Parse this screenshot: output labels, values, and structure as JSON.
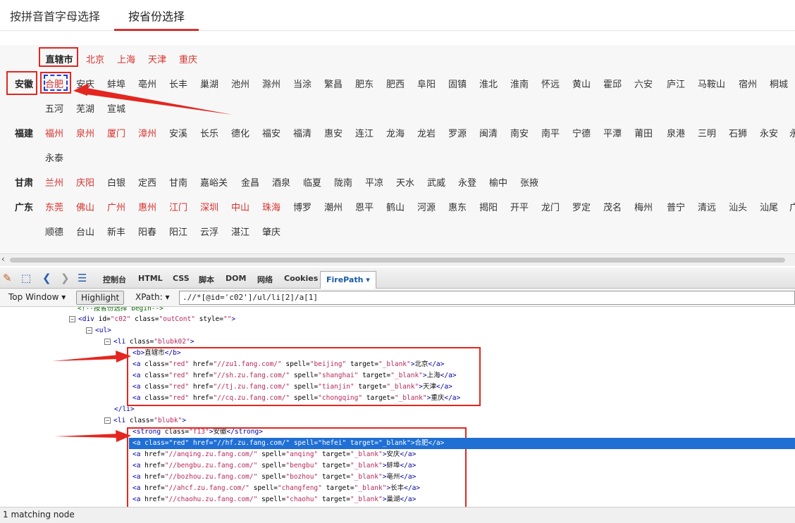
{
  "tabs": {
    "pinyin": "按拼音首字母选择",
    "province": "按省份选择"
  },
  "provinces": {
    "zhixiashi": {
      "label": "直辖市",
      "cities": [
        "北京",
        "上海",
        "天津",
        "重庆"
      ]
    },
    "anhui": {
      "label": "安徽",
      "cities": [
        "合肥",
        "安庆",
        "蚌埠",
        "亳州",
        "长丰",
        "巢湖",
        "池州",
        "滁州",
        "当涂",
        "繁昌",
        "肥东",
        "肥西",
        "阜阳",
        "固镇",
        "淮北",
        "淮南",
        "怀远",
        "黄山",
        "霍邱",
        "六安",
        "庐江",
        "马鞍山",
        "宿州",
        "桐城"
      ],
      "cities2": [
        "五河",
        "芜湖",
        "宣城"
      ]
    },
    "fujian": {
      "label": "福建",
      "cities": [
        "福州",
        "泉州",
        "厦门",
        "漳州",
        "安溪",
        "长乐",
        "德化",
        "福安",
        "福清",
        "惠安",
        "连江",
        "龙海",
        "龙岩",
        "罗源",
        "闽清",
        "南安",
        "南平",
        "宁德",
        "平潭",
        "莆田",
        "泉港",
        "三明",
        "石狮",
        "永安",
        "永"
      ],
      "cities2": [
        "永泰"
      ]
    },
    "gansu": {
      "label": "甘肃",
      "cities": [
        "兰州",
        "庆阳",
        "白银",
        "定西",
        "甘南",
        "嘉峪关",
        "金昌",
        "酒泉",
        "临夏",
        "陇南",
        "平凉",
        "天水",
        "武威",
        "永登",
        "榆中",
        "张掖"
      ]
    },
    "guangdong": {
      "label": "广东",
      "cities": [
        "东莞",
        "佛山",
        "广州",
        "惠州",
        "江门",
        "深圳",
        "中山",
        "珠海",
        "博罗",
        "潮州",
        "恩平",
        "鹤山",
        "河源",
        "惠东",
        "揭阳",
        "开平",
        "龙门",
        "罗定",
        "茂名",
        "梅州",
        "普宁",
        "清远",
        "汕头",
        "汕尾",
        "广"
      ],
      "cities2": [
        "顺德",
        "台山",
        "新丰",
        "阳春",
        "阳江",
        "云浮",
        "湛江",
        "肇庆"
      ]
    }
  },
  "firebug": {
    "tabs": [
      "控制台",
      "HTML",
      "CSS",
      "脚本",
      "DOM",
      "网络",
      "Cookies"
    ],
    "active_tab": "FirePath ▾",
    "top_window": "Top Window ▾",
    "highlight": "Highlight",
    "xpath_label": "XPath: ▾",
    "xpath_value": ".//*[@id='c02']/ul/li[2]/a[1]"
  },
  "code": {
    "l0": "<!--按省份选择 begin-->",
    "l1a": "<div",
    "l1b": " id=",
    "l1c": "\"c02\"",
    "l1d": " class=",
    "l1e": "\"outCont\"",
    "l1f": " style=",
    "l1g": "\"\"",
    "l1h": ">",
    "l2": "<ul>",
    "l3a": "<li",
    "l3b": " class=",
    "l3c": "\"blubk02\"",
    "l3d": ">",
    "l4a": "<b>",
    "l4b": "直辖市",
    "l4c": "</b>",
    "a1": {
      "href": "\"//zu1.fang.com/\"",
      "spell": "\"beijing\"",
      "text": "北京"
    },
    "a2": {
      "href": "\"//sh.zu.fang.com/\"",
      "spell": "\"shanghai\"",
      "text": "上海"
    },
    "a3": {
      "href": "\"//tj.zu.fang.com/\"",
      "spell": "\"tianjin\"",
      "text": "天津"
    },
    "a4": {
      "href": "\"//cq.zu.fang.com/\"",
      "spell": "\"chongqing\"",
      "text": "重庆"
    },
    "li_close": "</li>",
    "l5a": "<li",
    "l5b": " class=",
    "l5c": "\"blubk\"",
    "l5d": ">",
    "l6a": "<strong",
    "l6b": " class=",
    "l6c": "\"f13\"",
    "l6d": ">",
    "l6e": "安徽",
    "l6f": "</strong>",
    "b1": {
      "href": "\"//hf.zu.fang.com/\"",
      "spell": "\"hefei\"",
      "text": "合肥"
    },
    "b2": {
      "href": "\"//anqing.zu.fang.com/\"",
      "spell": "\"anqing\"",
      "text": "安庆"
    },
    "b3": {
      "href": "\"//bengbu.zu.fang.com/\"",
      "spell": "\"bengbu\"",
      "text": "蚌埠"
    },
    "b4": {
      "href": "\"//bozhou.zu.fang.com/\"",
      "spell": "\"bozhou\"",
      "text": "亳州"
    },
    "b5": {
      "href": "\"//ahcf.zu.fang.com/\"",
      "spell": "\"changfeng\"",
      "text": "长丰"
    },
    "b6": {
      "href": "\"//chaohu.zu.fang.com/\"",
      "spell": "\"chaohu\"",
      "text": "巢湖"
    },
    "a_open": "<a",
    "class_attr": " class=",
    "red": "\"red\"",
    "href_attr": " href=",
    "spell_attr": " spell=",
    "target_attr": " target=",
    "blank": "\"_blank\"",
    "gt": ">",
    "a_close": "</a>"
  },
  "status": "1 matching node",
  "colors": {
    "accent": "#d6322e",
    "selection": "#1f6fd4",
    "annotation": "#e3261f"
  }
}
